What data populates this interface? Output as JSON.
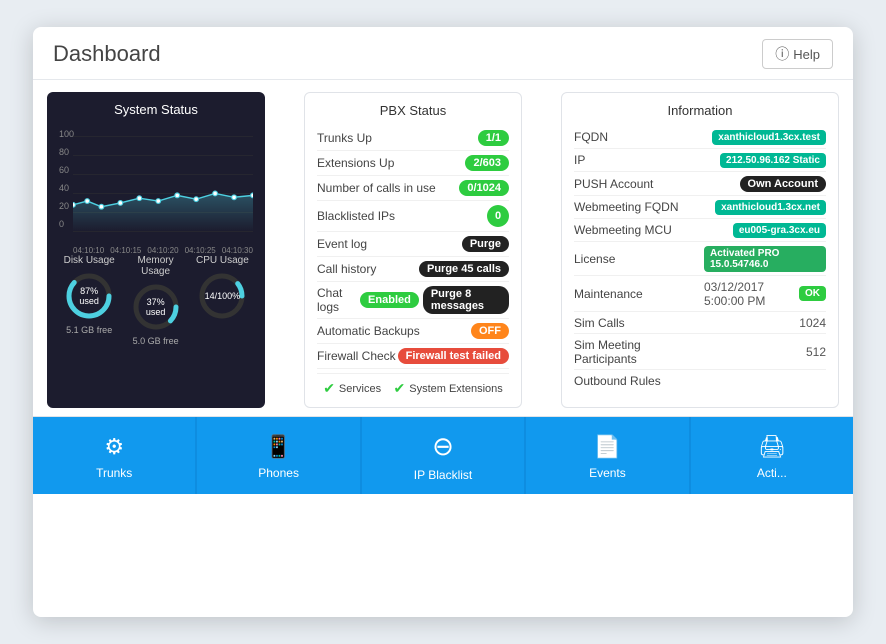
{
  "header": {
    "title": "Dashboard",
    "help_label": "Help"
  },
  "system_status": {
    "title": "System Status",
    "chart": {
      "y_labels": [
        "100",
        "80",
        "60",
        "40",
        "20",
        "0"
      ],
      "x_labels": [
        "04:10:10",
        "04:10:15",
        "04:10:20",
        "04:10:25",
        "04:10:30"
      ]
    },
    "disk_usage": {
      "label": "Disk Usage",
      "percent": 87,
      "used_text": "87% used",
      "sub": "5.1 GB free"
    },
    "memory_usage": {
      "label": "Memory Usage",
      "percent": 37,
      "used_text": "37% used",
      "sub": "5.0 GB free"
    },
    "cpu_usage": {
      "label": "CPU Usage",
      "used_text": "14/100%",
      "percent": 14
    }
  },
  "pbx_status": {
    "title": "PBX Status",
    "rows": [
      {
        "label": "Trunks Up",
        "value": "1/1",
        "badge_type": "green"
      },
      {
        "label": "Extensions Up",
        "value": "2/603",
        "badge_type": "green"
      },
      {
        "label": "Number of calls in use",
        "value": "0/1024",
        "badge_type": "green"
      },
      {
        "label": "Blacklisted IPs",
        "value": "0",
        "badge_type": "zero_green"
      },
      {
        "label": "Event log",
        "value": "Purge",
        "badge_type": "dark"
      },
      {
        "label": "Call history",
        "value": "Purge 45 calls",
        "badge_type": "dark"
      },
      {
        "label": "Chat logs",
        "value_enabled": "Enabled",
        "value_purge": "Purge 8 messages",
        "badge_type": "dual"
      },
      {
        "label": "Automatic Backups",
        "value": "OFF",
        "badge_type": "orange"
      },
      {
        "label": "Firewall Check",
        "value": "Firewall test failed",
        "badge_type": "red"
      }
    ],
    "footer": {
      "services_label": "Services",
      "system_extensions_label": "System Extensions"
    }
  },
  "information": {
    "title": "Information",
    "rows": [
      {
        "label": "FQDN",
        "value": "xanthicloud1.3cx.test",
        "badge_type": "teal"
      },
      {
        "label": "IP",
        "value": "212.50.96.162 Static",
        "badge_type": "teal"
      },
      {
        "label": "PUSH Account",
        "value": "Own Account",
        "badge_type": "dark"
      },
      {
        "label": "Webmeeting FQDN",
        "value": "xanthicloud1.3cx.net",
        "badge_type": "teal"
      },
      {
        "label": "Webmeeting MCU",
        "value": "eu005-gra.3cx.eu",
        "badge_type": "teal"
      },
      {
        "label": "License",
        "value": "Activated PRO 15.0.54746.0",
        "badge_type": "activated"
      },
      {
        "label": "Maintenance",
        "value_text": "03/12/2017 5:00:00 PM",
        "value_badge": "OK",
        "badge_type": "ok_inline"
      },
      {
        "label": "Sim Calls",
        "value": "1024",
        "badge_type": "plain"
      },
      {
        "label": "Sim Meeting Participants",
        "value": "512",
        "badge_type": "plain"
      },
      {
        "label": "Outbound Rules",
        "value": "",
        "badge_type": "plain"
      }
    ]
  },
  "toolbar": {
    "buttons": [
      {
        "label": "Trunks",
        "icon": "⚙"
      },
      {
        "label": "Phones",
        "icon": "📱"
      },
      {
        "label": "IP Blacklist",
        "icon": "⊖"
      },
      {
        "label": "Events",
        "icon": "📄"
      },
      {
        "label": "Acti...",
        "icon": "🖨"
      }
    ]
  }
}
